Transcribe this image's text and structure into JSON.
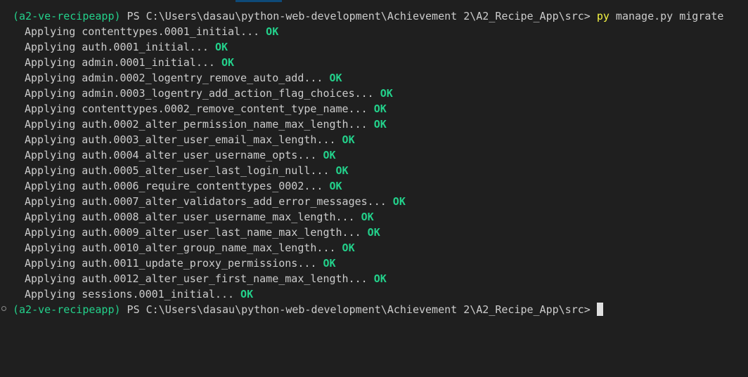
{
  "prompt1": {
    "env": "(a2-ve-recipeapp)",
    "ps": " PS C:\\Users\\dasau\\python-web-development\\Achievement 2\\A2_Recipe_App\\src> ",
    "cmd_exe": "py",
    "cmd_args": " manage.py migrate"
  },
  "migrations": [
    {
      "text": "Applying contenttypes.0001_initial... ",
      "status": "OK"
    },
    {
      "text": "Applying auth.0001_initial... ",
      "status": "OK"
    },
    {
      "text": "Applying admin.0001_initial... ",
      "status": "OK"
    },
    {
      "text": "Applying admin.0002_logentry_remove_auto_add... ",
      "status": "OK"
    },
    {
      "text": "Applying admin.0003_logentry_add_action_flag_choices... ",
      "status": "OK"
    },
    {
      "text": "Applying contenttypes.0002_remove_content_type_name... ",
      "status": "OK"
    },
    {
      "text": "Applying auth.0002_alter_permission_name_max_length... ",
      "status": "OK"
    },
    {
      "text": "Applying auth.0003_alter_user_email_max_length... ",
      "status": "OK"
    },
    {
      "text": "Applying auth.0004_alter_user_username_opts... ",
      "status": "OK"
    },
    {
      "text": "Applying auth.0005_alter_user_last_login_null... ",
      "status": "OK"
    },
    {
      "text": "Applying auth.0006_require_contenttypes_0002... ",
      "status": "OK"
    },
    {
      "text": "Applying auth.0007_alter_validators_add_error_messages... ",
      "status": "OK"
    },
    {
      "text": "Applying auth.0008_alter_user_username_max_length... ",
      "status": "OK"
    },
    {
      "text": "Applying auth.0009_alter_user_last_name_max_length... ",
      "status": "OK"
    },
    {
      "text": "Applying auth.0010_alter_group_name_max_length... ",
      "status": "OK"
    },
    {
      "text": "Applying auth.0011_update_proxy_permissions... ",
      "status": "OK"
    },
    {
      "text": "Applying auth.0012_alter_user_first_name_max_length... ",
      "status": "OK"
    },
    {
      "text": "Applying sessions.0001_initial... ",
      "status": "OK"
    }
  ],
  "prompt2": {
    "env": "(a2-ve-recipeapp)",
    "ps": " PS C:\\Users\\dasau\\python-web-development\\Achievement 2\\A2_Recipe_App\\src> "
  },
  "colors": {
    "background": "#1f1f1f",
    "text": "#cccccc",
    "ok": "#23d18b",
    "command": "#f5f543"
  }
}
